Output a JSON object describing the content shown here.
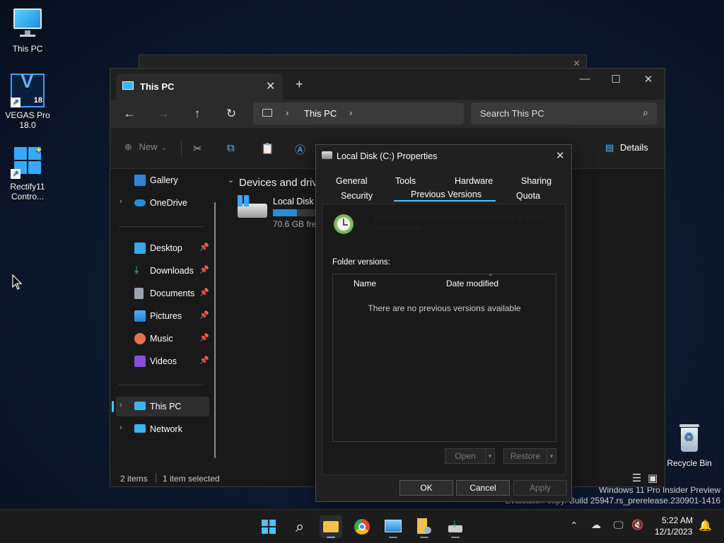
{
  "desktop": {
    "icons": [
      {
        "label": "This PC"
      },
      {
        "label": "VEGAS Pro\n18.0",
        "badge": "V",
        "version": "18"
      },
      {
        "label": "Rectify11\nContro..."
      }
    ],
    "recycle_bin": "Recycle Bin",
    "watermark_line1": "Windows 11 Pro Insider Preview",
    "watermark_line2": "Evaluation copy. Build 25947.rs_prerelease.230901-1416"
  },
  "explorer": {
    "tab_title": "This PC",
    "tab_close": "✕",
    "tab_new": "+",
    "window_controls": {
      "minimize": "—",
      "maximize": "☐",
      "close": "✕"
    },
    "address": {
      "location": "This PC"
    },
    "search_placeholder": "Search This PC",
    "toolbar": {
      "new_label": "New",
      "details_label": "Details"
    },
    "sidebar": [
      {
        "label": "Gallery"
      },
      {
        "label": "OneDrive"
      },
      {
        "label": "Desktop"
      },
      {
        "label": "Downloads"
      },
      {
        "label": "Documents"
      },
      {
        "label": "Pictures"
      },
      {
        "label": "Music"
      },
      {
        "label": "Videos"
      },
      {
        "label": "This PC"
      },
      {
        "label": "Network"
      }
    ],
    "section_header": "Devices and driv",
    "drive": {
      "name": "Local Disk (",
      "free": "70.6 GB free",
      "used_fraction": 0.55
    },
    "status": {
      "items": "2 items",
      "selected": "1 item selected"
    }
  },
  "dialog": {
    "title": "Local Disk (C:) Properties",
    "tabs_row1": [
      "General",
      "Tools",
      "Hardware",
      "Sharing"
    ],
    "tabs_row2": [
      "Security",
      "Previous Versions",
      "Quota"
    ],
    "active_tab": "Previous Versions",
    "info_text": "Previous versions come from File History or from restore points.",
    "folder_versions_label": "Folder versions:",
    "columns": [
      "Name",
      "Date modified"
    ],
    "empty_message": "There are no previous versions available",
    "open_label": "Open",
    "restore_label": "Restore",
    "ok_label": "OK",
    "cancel_label": "Cancel",
    "apply_label": "Apply"
  },
  "taskbar": {
    "time": "5:22 AM",
    "date": "12/1/2023"
  },
  "colors": {
    "accent": "#4cc2ff",
    "drive_bar": "#2a8bd8"
  }
}
